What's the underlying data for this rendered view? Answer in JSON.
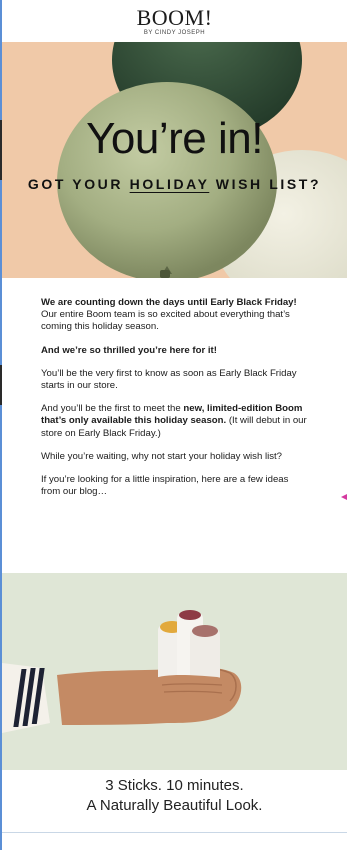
{
  "brand": {
    "name": "BOOM!",
    "tagline": "BY CINDY JOSEPH"
  },
  "hero": {
    "title": "You’re in!",
    "subtitle_pre": "GOT YOUR ",
    "subtitle_emph": "HOLIDAY",
    "subtitle_post": " WISH LIST?"
  },
  "body": {
    "p1_bold": "We are counting down the days until Early Black Friday!",
    "p1_rest": " Our entire Boom team is so excited about everything that’s coming this holiday season.",
    "p2": "And we’re so thrilled you’re here for it!",
    "p3": "You’ll be the very first to know as soon as Early Black Friday starts in our store.",
    "p4_pre": "And you’ll be the first to meet the ",
    "p4_bold": "new, limited-edition Boom that’s only available this holiday season.",
    "p4_post": " (It will debut in our store on Early Black Friday.)",
    "p5": "While you’re waiting, why not start your holiday wish list?",
    "p6": "If you’re looking for a little inspiration, here are a few ideas from our blog…"
  },
  "product": {
    "line1": "3 Sticks. 10 minutes.",
    "line2": "A Naturally Beautiful Look."
  },
  "colors": {
    "hero_bg": "#f0c9a8",
    "balloon_sage": "#aab58a",
    "balloon_green": "#2f4a35",
    "product_bg": "#dfe6d6"
  }
}
